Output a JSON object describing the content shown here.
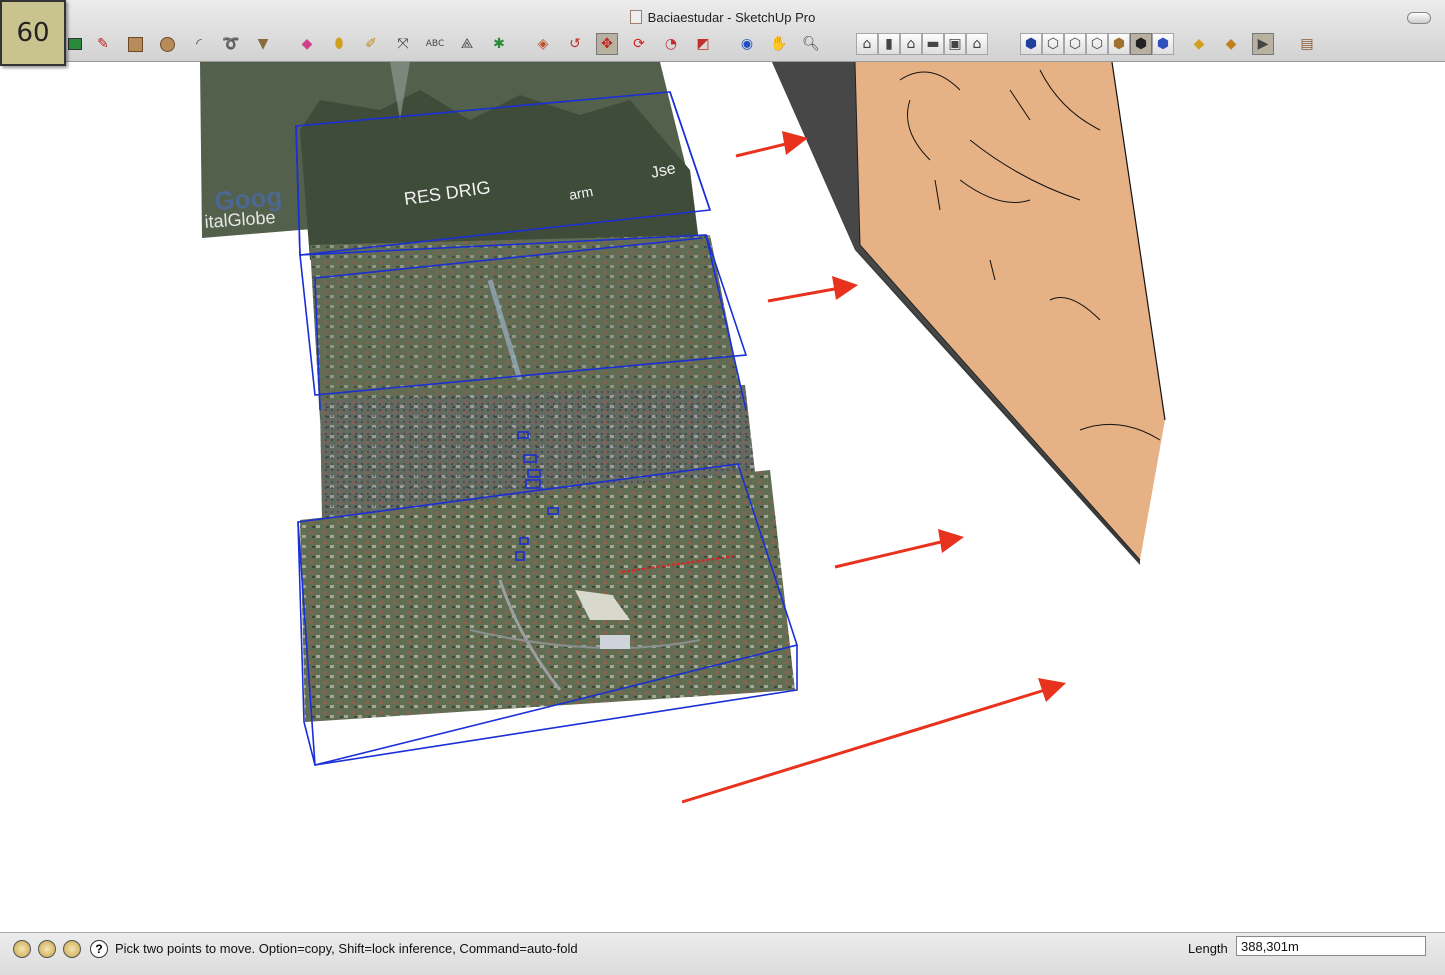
{
  "slide": {
    "number": "60"
  },
  "window": {
    "title": "Baciaestudar - SketchUp Pro"
  },
  "toolbar": {
    "tools": [
      "select-icon",
      "paint-bucket-icon",
      "pencil-icon",
      "rectangle-icon",
      "circle-icon",
      "arc-icon",
      "freehand-icon",
      "push-pull-icon",
      "eraser-icon",
      "paint-icon",
      "tape-measure-icon",
      "dimension-icon",
      "text-icon",
      "axes-icon",
      "3d-text-icon",
      "follow-me-icon",
      "offset-icon",
      "move-icon",
      "rotate-icon",
      "scale-icon",
      "section-plane-icon",
      "orbit-icon",
      "pan-icon",
      "zoom-icon"
    ],
    "views": [
      "iso-view-icon",
      "top-view-icon",
      "front-view-icon",
      "right-view-icon",
      "back-view-icon",
      "left-view-icon"
    ],
    "styles": [
      "xray-icon",
      "wireframe-icon",
      "hidden-line-icon",
      "shaded-icon",
      "shaded-texture-icon",
      "monochrome-icon",
      "style-icon"
    ],
    "extras": [
      "get-models-icon",
      "share-model-icon",
      "components-icon",
      "layers-icon"
    ]
  },
  "viewport": {
    "imagery_labels": {
      "watermark_google": "Goog",
      "watermark_digitalglobe": "italGlobe",
      "place_1": "RES DRIG",
      "place_2": "arm",
      "place_3": "Jse"
    },
    "arrow_color": "#e8321e",
    "selection_color": "#1a2fd6",
    "terrain_color": "#e8b384"
  },
  "statusbar": {
    "icons": [
      "geo-location-icon",
      "credits-icon",
      "user-icon"
    ],
    "help_label": "?",
    "message": "Pick two points to move.  Option=copy, Shift=lock inference, Command=auto-fold",
    "vcb_label": "Length",
    "vcb_value": "388,301m"
  }
}
